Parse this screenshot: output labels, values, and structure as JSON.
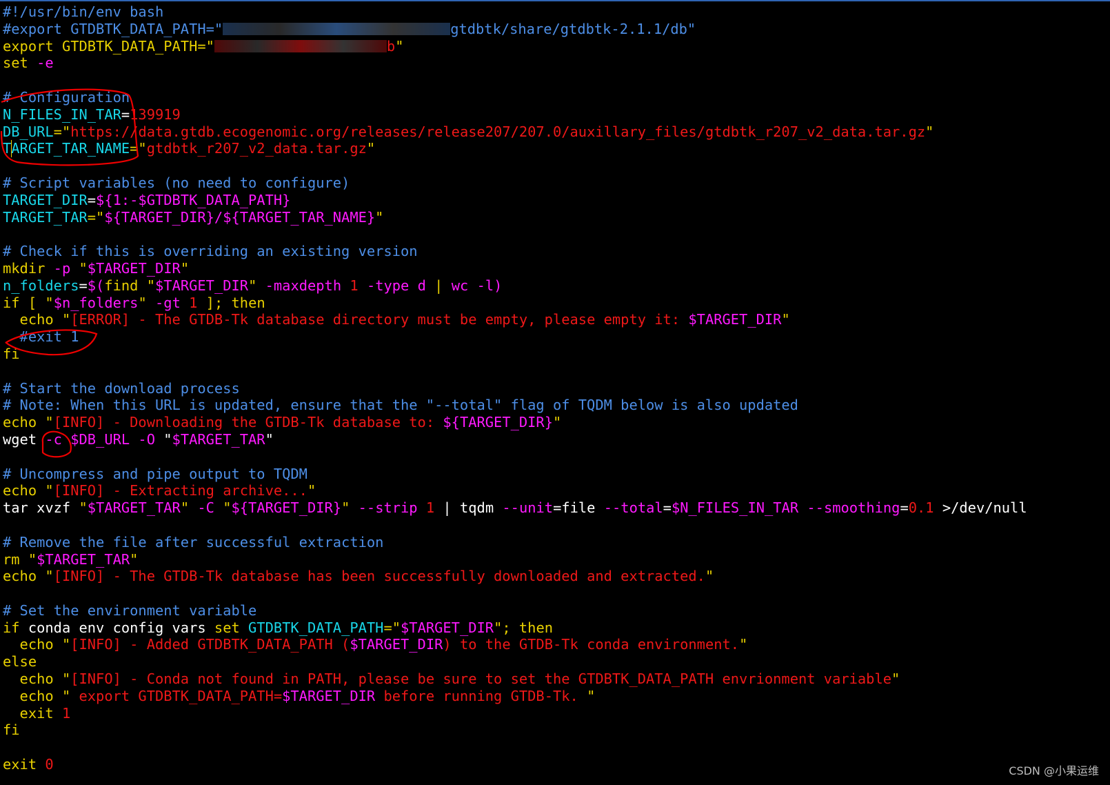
{
  "colors": {
    "default": "#ffffff",
    "comment": "#4d8ee6",
    "keyword": "#e8d000",
    "string": "#ee1818",
    "variable": "#ff1aff",
    "assign": "#19d6e8",
    "option": "#ff1aff",
    "number": "#ee1818",
    "annotation": "#ee0000",
    "watermark": "#bdbdbd"
  },
  "terminal": {
    "lines": [
      [
        {
          "t": "#!/usr/bin/env bash",
          "c": "comment"
        }
      ],
      [
        {
          "t": "#export GTDBTK_DATA_PATH=\"",
          "c": "comment"
        },
        {
          "redact": 330,
          "c": "comment"
        },
        {
          "t": "gtdbtk/share/gtdbtk-2.1.1/db\"",
          "c": "comment"
        }
      ],
      [
        {
          "t": "export",
          "c": "keyword"
        },
        {
          "t": " GTDBTK_DATA_PATH=\"",
          "c": "keyword"
        },
        {
          "redact": 250,
          "c": "string"
        },
        {
          "t": "b",
          "c": "string"
        },
        {
          "t": "\"",
          "c": "keyword"
        }
      ],
      [
        {
          "t": "set",
          "c": "keyword"
        },
        {
          "t": " -e",
          "c": "option"
        }
      ],
      [],
      [
        {
          "t": "# Configuration",
          "c": "comment"
        }
      ],
      [
        {
          "t": "N_FILES_IN_TAR",
          "c": "assign"
        },
        {
          "t": "=",
          "c": "default"
        },
        {
          "t": "139919",
          "c": "number"
        }
      ],
      [
        {
          "t": "DB_URL",
          "c": "assign"
        },
        {
          "t": "=\"",
          "c": "keyword"
        },
        {
          "t": "https://data.gtdb.ecogenomic.org/releases/release207/207.0/auxillary_files/gtdbtk_r207_v2_data.tar.gz",
          "c": "string"
        },
        {
          "t": "\"",
          "c": "keyword"
        }
      ],
      [
        {
          "t": "T",
          "c": "assign",
          "cursor": true
        },
        {
          "t": "ARGET_TAR_NAME",
          "c": "assign"
        },
        {
          "t": "=\"",
          "c": "keyword"
        },
        {
          "t": "gtdbtk_r207_v2_data.tar.gz",
          "c": "string"
        },
        {
          "t": "\"",
          "c": "keyword"
        }
      ],
      [],
      [
        {
          "t": "# Script variables (no need to configure)",
          "c": "comment"
        }
      ],
      [
        {
          "t": "TARGET_DIR",
          "c": "assign"
        },
        {
          "t": "=",
          "c": "default"
        },
        {
          "t": "${1:-$GTDBTK_DATA_PATH}",
          "c": "variable"
        }
      ],
      [
        {
          "t": "TARGET_TAR",
          "c": "assign"
        },
        {
          "t": "=\"",
          "c": "keyword"
        },
        {
          "t": "${TARGET_DIR}/${TARGET_TAR_NAME}",
          "c": "variable"
        },
        {
          "t": "\"",
          "c": "keyword"
        }
      ],
      [],
      [
        {
          "t": "# Check if this is overriding an existing version",
          "c": "comment"
        }
      ],
      [
        {
          "t": "mkdir",
          "c": "keyword"
        },
        {
          "t": " -p ",
          "c": "option"
        },
        {
          "t": "\"",
          "c": "keyword"
        },
        {
          "t": "$TARGET_DIR",
          "c": "variable"
        },
        {
          "t": "\"",
          "c": "keyword"
        }
      ],
      [
        {
          "t": "n_folders",
          "c": "assign"
        },
        {
          "t": "=",
          "c": "default"
        },
        {
          "t": "$(",
          "c": "variable"
        },
        {
          "t": "find ",
          "c": "keyword"
        },
        {
          "t": "\"",
          "c": "keyword"
        },
        {
          "t": "$TARGET_DIR",
          "c": "variable"
        },
        {
          "t": "\" ",
          "c": "keyword"
        },
        {
          "t": "-maxdepth ",
          "c": "option"
        },
        {
          "t": "1",
          "c": "number"
        },
        {
          "t": " -type d ",
          "c": "option"
        },
        {
          "t": "| ",
          "c": "keyword"
        },
        {
          "t": "wc -l)",
          "c": "option"
        }
      ],
      [
        {
          "t": "if",
          "c": "keyword"
        },
        {
          "t": " [ ",
          "c": "keyword"
        },
        {
          "t": "\"",
          "c": "keyword"
        },
        {
          "t": "$n_folders",
          "c": "variable"
        },
        {
          "t": "\" ",
          "c": "keyword"
        },
        {
          "t": "-gt ",
          "c": "option"
        },
        {
          "t": "1",
          "c": "number"
        },
        {
          "t": " ]; then",
          "c": "keyword"
        }
      ],
      [
        {
          "t": "  echo ",
          "c": "keyword"
        },
        {
          "t": "\"",
          "c": "keyword"
        },
        {
          "t": "[ERROR] - The GTDB-Tk database directory must be empty, please empty it: ",
          "c": "string"
        },
        {
          "t": "$TARGET_DIR",
          "c": "variable"
        },
        {
          "t": "\"",
          "c": "keyword"
        }
      ],
      [
        {
          "t": "  #exit 1",
          "c": "comment"
        }
      ],
      [
        {
          "t": "fi",
          "c": "keyword"
        }
      ],
      [],
      [
        {
          "t": "# Start the download process",
          "c": "comment"
        }
      ],
      [
        {
          "t": "# Note: When this URL is updated, ensure that the \"--total\" flag of TQDM below is also updated",
          "c": "comment"
        }
      ],
      [
        {
          "t": "echo ",
          "c": "keyword"
        },
        {
          "t": "\"",
          "c": "keyword"
        },
        {
          "t": "[INFO] - Downloading the GTDB-Tk database to: ",
          "c": "string"
        },
        {
          "t": "${TARGET_DIR}",
          "c": "variable"
        },
        {
          "t": "\"",
          "c": "keyword"
        }
      ],
      [
        {
          "t": "wget",
          "c": "default"
        },
        {
          "t": " -c ",
          "c": "option"
        },
        {
          "t": "$DB_URL",
          "c": "variable"
        },
        {
          "t": " -O ",
          "c": "option"
        },
        {
          "t": "\"",
          "c": "default"
        },
        {
          "t": "$TARGET_TAR",
          "c": "variable"
        },
        {
          "t": "\"",
          "c": "default"
        }
      ],
      [],
      [
        {
          "t": "# Uncompress and pipe output to TQDM",
          "c": "comment"
        }
      ],
      [
        {
          "t": "echo ",
          "c": "keyword"
        },
        {
          "t": "\"",
          "c": "keyword"
        },
        {
          "t": "[INFO] - Extracting archive...",
          "c": "string"
        },
        {
          "t": "\"",
          "c": "keyword"
        }
      ],
      [
        {
          "t": "tar xvzf ",
          "c": "default"
        },
        {
          "t": "\"",
          "c": "keyword"
        },
        {
          "t": "$TARGET_TAR",
          "c": "variable"
        },
        {
          "t": "\"",
          "c": "keyword"
        },
        {
          "t": " -C ",
          "c": "option"
        },
        {
          "t": "\"",
          "c": "keyword"
        },
        {
          "t": "${TARGET_DIR}",
          "c": "variable"
        },
        {
          "t": "\"",
          "c": "keyword"
        },
        {
          "t": " --strip ",
          "c": "option"
        },
        {
          "t": "1",
          "c": "number"
        },
        {
          "t": " | ",
          "c": "default"
        },
        {
          "t": "tqdm ",
          "c": "default"
        },
        {
          "t": "--unit",
          "c": "option"
        },
        {
          "t": "=",
          "c": "default"
        },
        {
          "t": "file ",
          "c": "default"
        },
        {
          "t": "--total",
          "c": "option"
        },
        {
          "t": "=",
          "c": "default"
        },
        {
          "t": "$N_FILES_IN_TAR",
          "c": "variable"
        },
        {
          "t": " --smoothing",
          "c": "option"
        },
        {
          "t": "=",
          "c": "default"
        },
        {
          "t": "0.1",
          "c": "number"
        },
        {
          "t": " >/dev/null",
          "c": "default"
        }
      ],
      [],
      [
        {
          "t": "# Remove the file after successful extraction",
          "c": "comment"
        }
      ],
      [
        {
          "t": "rm ",
          "c": "keyword"
        },
        {
          "t": "\"",
          "c": "keyword"
        },
        {
          "t": "$TARGET_TAR",
          "c": "variable"
        },
        {
          "t": "\"",
          "c": "keyword"
        }
      ],
      [
        {
          "t": "echo ",
          "c": "keyword"
        },
        {
          "t": "\"",
          "c": "keyword"
        },
        {
          "t": "[INFO] - The GTDB-Tk database has been successfully downloaded and extracted.",
          "c": "string"
        },
        {
          "t": "\"",
          "c": "keyword"
        }
      ],
      [],
      [
        {
          "t": "# Set the environment variable",
          "c": "comment"
        }
      ],
      [
        {
          "t": "if",
          "c": "keyword"
        },
        {
          "t": " conda env config vars ",
          "c": "default"
        },
        {
          "t": "set ",
          "c": "keyword"
        },
        {
          "t": "GTDBTK_DATA_PATH",
          "c": "assign"
        },
        {
          "t": "=\"",
          "c": "keyword"
        },
        {
          "t": "$TARGET_DIR",
          "c": "variable"
        },
        {
          "t": "\"; then",
          "c": "keyword"
        }
      ],
      [
        {
          "t": "  echo ",
          "c": "keyword"
        },
        {
          "t": "\"",
          "c": "keyword"
        },
        {
          "t": "[INFO] - Added GTDBTK_DATA_PATH (",
          "c": "string"
        },
        {
          "t": "$TARGET_DIR",
          "c": "variable"
        },
        {
          "t": ") to the GTDB-Tk conda environment.",
          "c": "string"
        },
        {
          "t": "\"",
          "c": "keyword"
        }
      ],
      [
        {
          "t": "else",
          "c": "keyword"
        }
      ],
      [
        {
          "t": "  echo ",
          "c": "keyword"
        },
        {
          "t": "\"",
          "c": "keyword"
        },
        {
          "t": "[INFO] - Conda not found in PATH, please be sure to set the GTDBTK_DATA_PATH envrionment variable",
          "c": "string"
        },
        {
          "t": "\"",
          "c": "keyword"
        }
      ],
      [
        {
          "t": "  echo ",
          "c": "keyword"
        },
        {
          "t": "\"",
          "c": "keyword"
        },
        {
          "t": " export GTDBTK_DATA_PATH=",
          "c": "string"
        },
        {
          "t": "$TARGET_DIR",
          "c": "variable"
        },
        {
          "t": " before running GTDB-Tk. ",
          "c": "string"
        },
        {
          "t": "\"",
          "c": "keyword"
        }
      ],
      [
        {
          "t": "  exit ",
          "c": "keyword"
        },
        {
          "t": "1",
          "c": "number"
        }
      ],
      [
        {
          "t": "fi",
          "c": "keyword"
        }
      ],
      [],
      [
        {
          "t": "exit ",
          "c": "keyword"
        },
        {
          "t": "0",
          "c": "number"
        }
      ]
    ]
  },
  "watermark": "CSDN @小果运维"
}
